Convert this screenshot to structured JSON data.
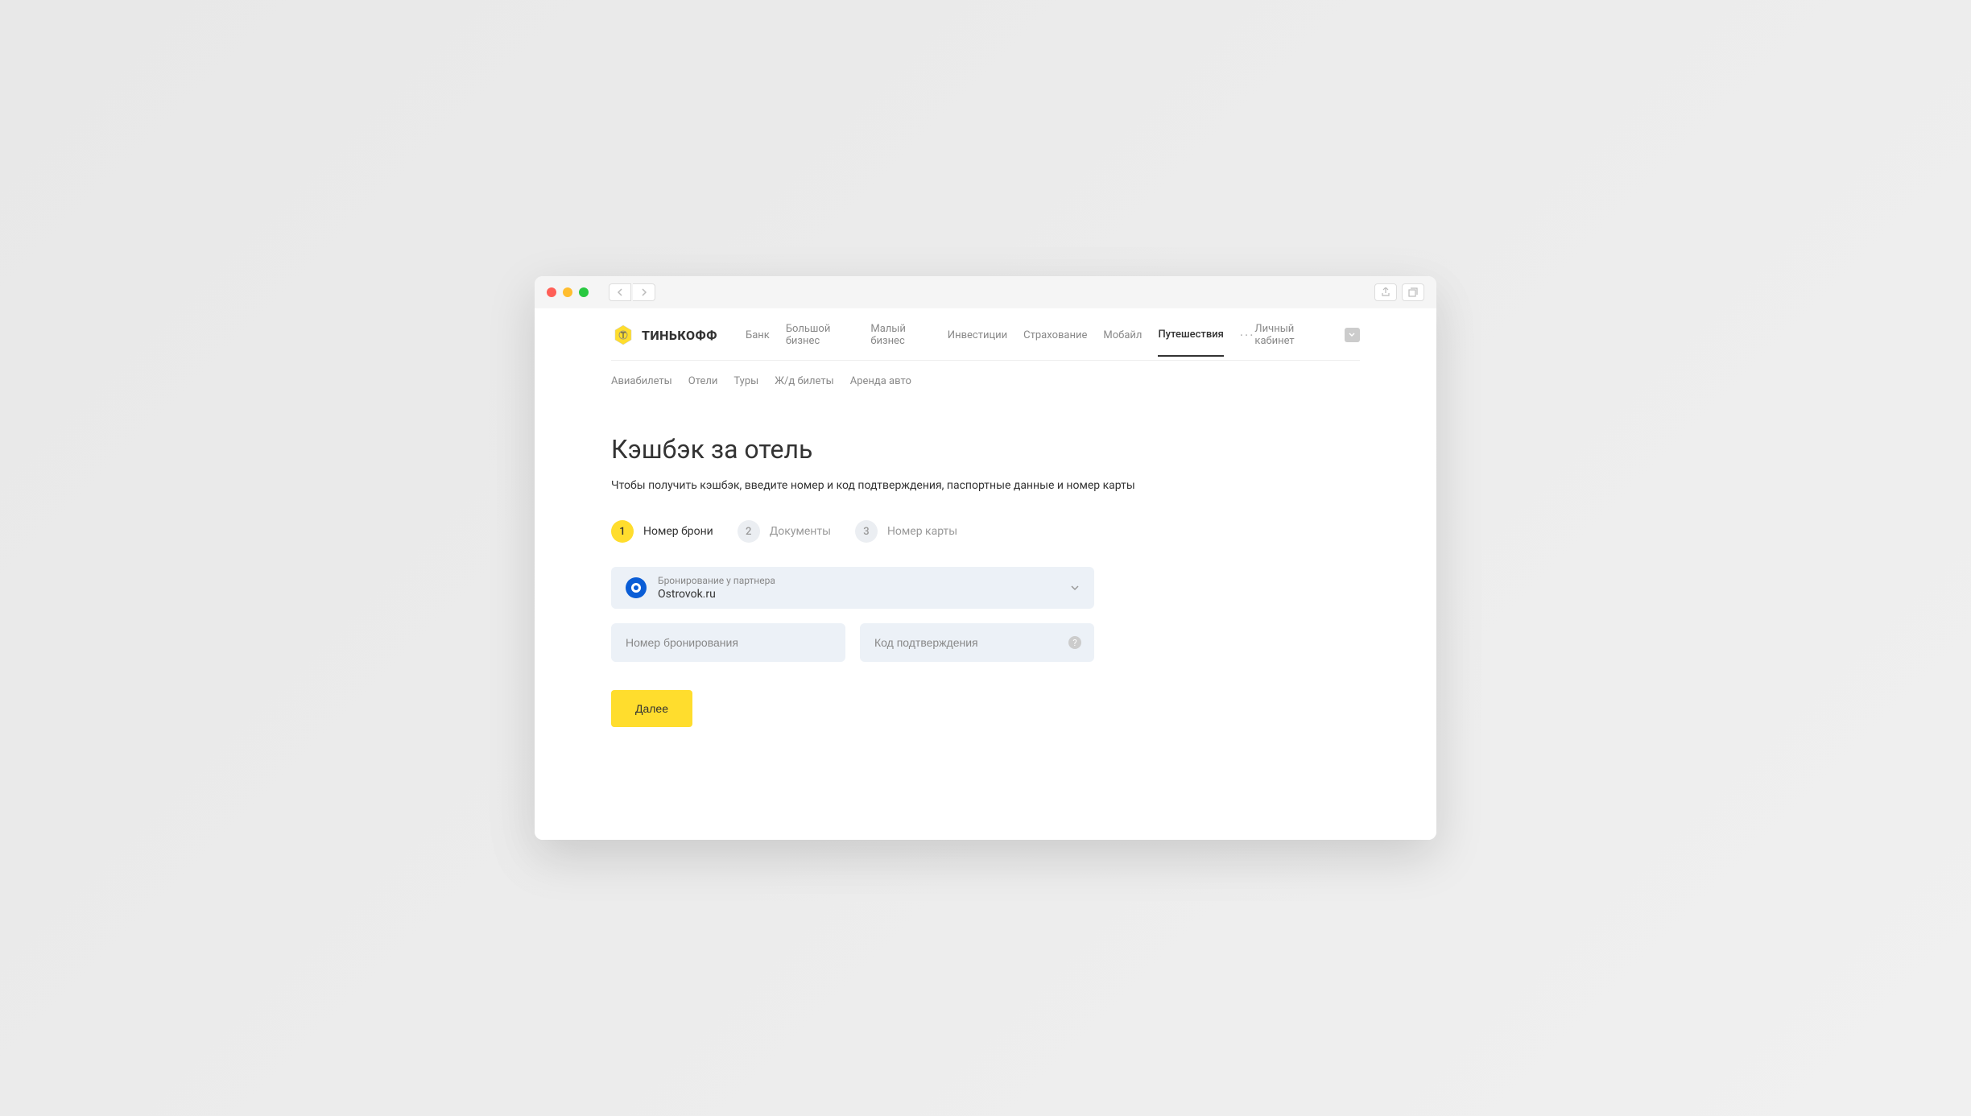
{
  "logo": {
    "text": "ТИНЬКОФФ"
  },
  "mainNav": {
    "items": [
      {
        "label": "Банк",
        "active": false
      },
      {
        "label": "Большой бизнес",
        "active": false
      },
      {
        "label": "Малый бизнес",
        "active": false
      },
      {
        "label": "Инвестиции",
        "active": false
      },
      {
        "label": "Страхование",
        "active": false
      },
      {
        "label": "Мобайл",
        "active": false
      },
      {
        "label": "Путешествия",
        "active": true
      }
    ]
  },
  "account": {
    "label": "Личный кабинет"
  },
  "subNav": {
    "items": [
      {
        "label": "Авиабилеты"
      },
      {
        "label": "Отели"
      },
      {
        "label": "Туры"
      },
      {
        "label": "Ж/д билеты"
      },
      {
        "label": "Аренда авто"
      }
    ]
  },
  "page": {
    "title": "Кэшбэк за отель",
    "subtitle": "Чтобы получить кэшбэк, введите номер и код подтверждения, паспортные данные и номер карты"
  },
  "stepper": {
    "steps": [
      {
        "number": "1",
        "label": "Номер брони",
        "active": true
      },
      {
        "number": "2",
        "label": "Документы",
        "active": false
      },
      {
        "number": "3",
        "label": "Номер карты",
        "active": false
      }
    ]
  },
  "form": {
    "partner": {
      "label": "Бронирование у партнера",
      "value": "Ostrovok.ru"
    },
    "bookingNumber": {
      "placeholder": "Номер бронирования"
    },
    "confirmationCode": {
      "placeholder": "Код подтверждения"
    },
    "submitButton": "Далее"
  }
}
